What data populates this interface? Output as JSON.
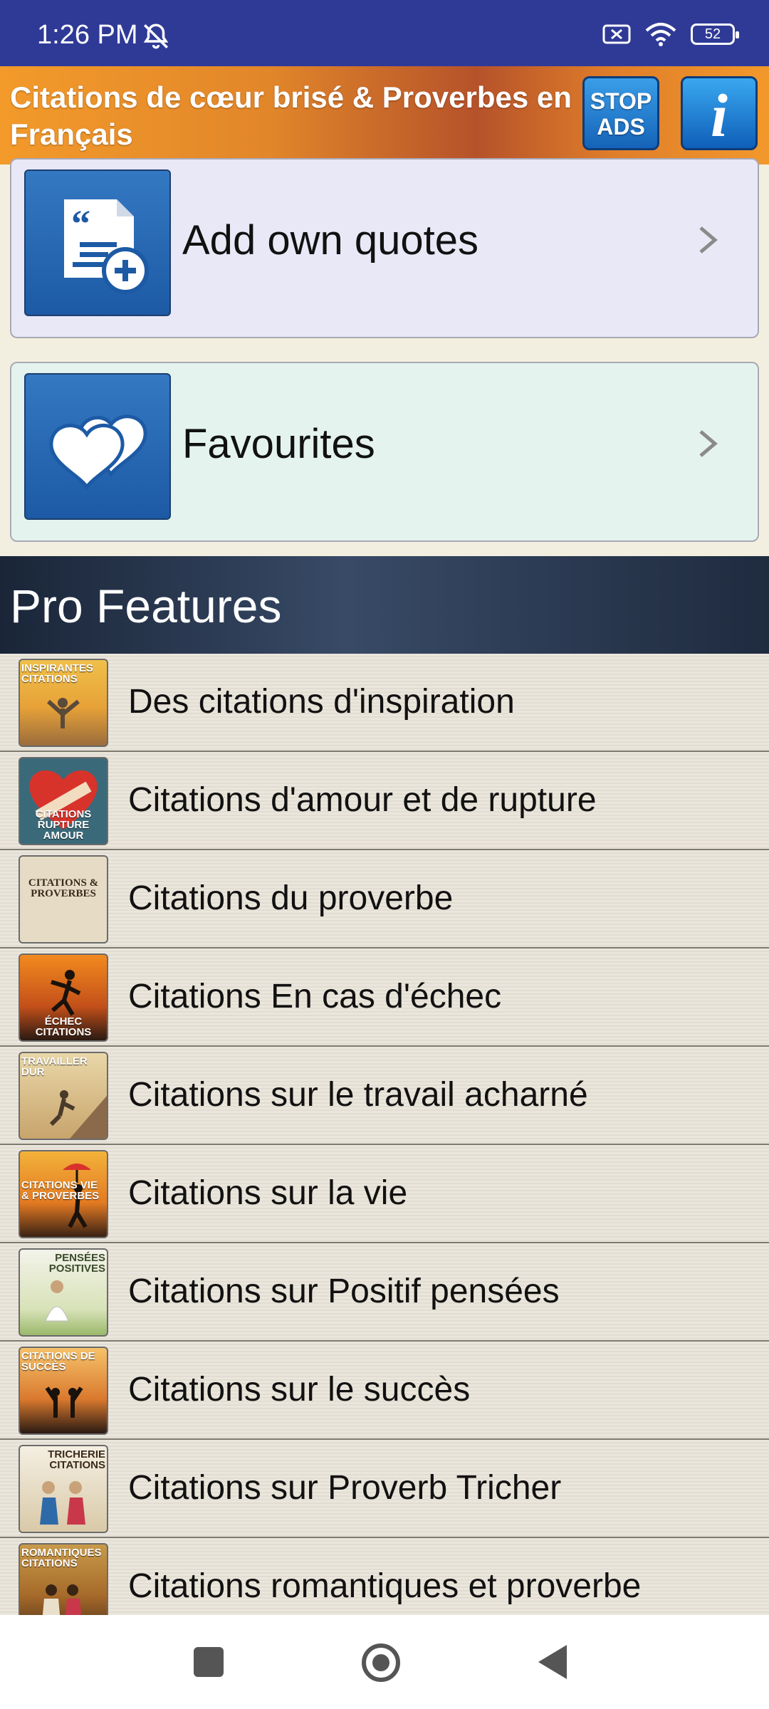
{
  "status_bar": {
    "time": "1:26 PM",
    "battery": "52"
  },
  "header": {
    "title": "Citations de cœur brisé & Proverbes en Français",
    "stop_ads_label": "STOP ADS",
    "info_label": "i"
  },
  "cards": [
    {
      "label": "Add own quotes",
      "icon": "add-document-icon"
    },
    {
      "label": "Favourites",
      "icon": "hearts-icon"
    }
  ],
  "pro": {
    "title": "Pro Features",
    "items": [
      {
        "label": "Des citations d'inspiration",
        "thumb_caption": "INSPIRANTES CITATIONS"
      },
      {
        "label": "Citations d'amour et de rupture",
        "thumb_caption": "CITATIONS RUPTURE AMOUR"
      },
      {
        "label": "Citations du proverbe",
        "thumb_caption": "CITATIONS & PROVERBES"
      },
      {
        "label": "Citations En cas d'échec",
        "thumb_caption": "ÉCHEC CITATIONS"
      },
      {
        "label": "Citations sur le travail acharné",
        "thumb_caption": "TRAVAILLER DUR"
      },
      {
        "label": "Citations sur la vie",
        "thumb_caption": "CITATIONS VIE & PROVERBES"
      },
      {
        "label": "Citations sur Positif pensées",
        "thumb_caption": "PENSÉES POSITIVES"
      },
      {
        "label": "Citations sur le succès",
        "thumb_caption": "CITATIONS DE SUCCÈS"
      },
      {
        "label": "Citations sur Proverb Tricher",
        "thumb_caption": "TRICHERIE CITATIONS"
      },
      {
        "label": "Citations romantiques et proverbe",
        "thumb_caption": "ROMANTIQUES CITATIONS"
      }
    ]
  },
  "colors": {
    "status_bar": "#2f3a97",
    "header_orange": "#f39a2a",
    "card_blue": "#1d5aa5",
    "pro_header": "#1a2538"
  }
}
